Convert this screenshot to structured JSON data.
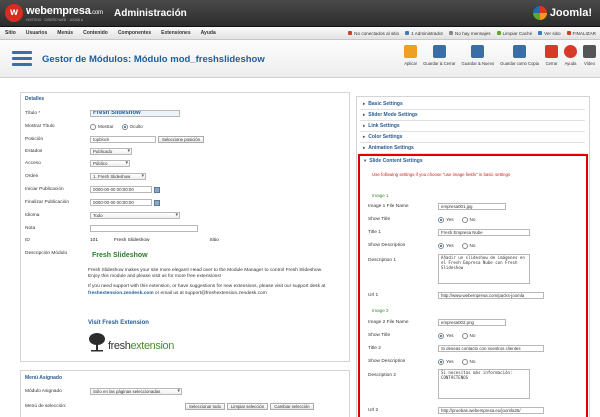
{
  "brand": {
    "logo_name": "webempresa",
    "logo_domain": ".com",
    "logo_sub": "HOSTING · DISEÑO WEB · JOOMLA",
    "admin_title": "Administración",
    "joomla": "Joomla!"
  },
  "menu": {
    "items": [
      "Sitio",
      "Usuarios",
      "Menús",
      "Contenido",
      "Componentes",
      "Extensiones",
      "Ayuda"
    ]
  },
  "status": [
    {
      "label": "No conectados al sitio",
      "color": "#d83a2a"
    },
    {
      "label": "1 Administrador",
      "color": "#3b7bbf"
    },
    {
      "label": "No hay mensajes",
      "color": "#888888"
    },
    {
      "label": "Limpiar Caché",
      "color": "#5aa82c"
    },
    {
      "label": "Ver sitio",
      "color": "#3b7bbf"
    },
    {
      "label": "FINALIZAR",
      "color": "#d83a2a"
    }
  ],
  "toolbar": {
    "title": "Gestor de Módulos: Módulo mod_freshslideshow",
    "buttons": [
      {
        "label": "Aplicar",
        "color": "#f0a020"
      },
      {
        "label": "Guardar & Cerrar",
        "color": "#3a6ea5"
      },
      {
        "label": "Guardar & Nuevo",
        "color": "#3a6ea5"
      },
      {
        "label": "Guardar como Copia",
        "color": "#3a6ea5"
      },
      {
        "label": "Cerrar",
        "color": "#d83a2a"
      },
      {
        "label": "Ayuda",
        "color": "#d83a2a"
      },
      {
        "label": "Vídeo",
        "color": "#555555"
      }
    ]
  },
  "details": {
    "heading": "Detalles",
    "title_label": "Título *",
    "title_value": "Fresh Slideshow",
    "show_title_label": "Mostrar Título",
    "show_opt": "Mostrar",
    "hide_opt": "Oculto",
    "position_label": "Posición",
    "position_value": "topblock",
    "position_button": "Seleccione posición",
    "state_label": "Estados",
    "state_value": "Publicado",
    "access_label": "Acceso",
    "access_value": "Público",
    "order_label": "Orden",
    "order_value": "1. Fresh Slideshow",
    "pub_start_label": "Iniciar Publicación",
    "pub_start_value": "0000-00-00 00:00:00",
    "pub_end_label": "Finalizar Publicación",
    "pub_end_value": "0000-00-00 00:00:00",
    "lang_label": "Idioma",
    "lang_value": "Todo",
    "note_label": "Nota",
    "note_value": "",
    "id_label": "ID",
    "id_value": "101",
    "id_name": "Fresh Slideshow",
    "id_site": "Sitio",
    "desc_label": "Descripción Módulo"
  },
  "module_desc": {
    "heading": "Fresh Slideshow",
    "para1": "Fresh Slideshow makes your site more elegant! Head over to the Module Manager to control Fresh Slideshow.",
    "para1b": "Enjoy this module and please visit us for more free extensions!",
    "para2": "If you need support with this extension, or have suggestions for new extensions, please visit our support desk at",
    "link1": "freshextension.zendesk.com",
    "or_email": " or email us at support@freshextension.zendesk.com",
    "visit": "Visit Fresh Extension",
    "logo_a": "fresh",
    "logo_b": "extension"
  },
  "menu_assign": {
    "heading": "Menú Asignado",
    "assign_label": "Módulo Asignado",
    "assign_value": "Sólo en las páginas seleccionadas",
    "sel_label": "Menú de selección:",
    "btn_all": "Seleccionar todo",
    "btn_clear": "Limpiar selección",
    "btn_toggle": "Cambiar selección"
  },
  "accordion": [
    "Basic Settings",
    "Slider Mode Settings",
    "Link Settings",
    "Color Settings",
    "Animation Settings"
  ],
  "slide": {
    "title": "Slide Content Settings",
    "note": "Use following settings if you choose \"use image fields\" in basic settings",
    "yes": "Yes",
    "no": "No",
    "img1": {
      "label": "Image 1",
      "file_label": "Image 1 File Name",
      "file_value": "empresa001.jpg",
      "show_title_label": "Show Title",
      "title_label": "Title 1",
      "title_value": "Fresh Empresa Nube",
      "show_desc_label": "Show Description",
      "desc_label": "Description 1",
      "desc_value": "Añadir un slideshow de imágenes en el Fresh Empresa Nube con Fresh Slideshow",
      "url_label": "Url 1",
      "url_value": "http://www.webempresa.com/packs-joomla"
    },
    "img2": {
      "label": "Image 2",
      "file_label": "Image 2 File Name",
      "file_value": "empresa002.png",
      "show_title_label": "Show Title",
      "title_label": "Title 2",
      "title_value": "Si deseas contacto con nuestros clientes",
      "show_desc_label": "Show Description",
      "desc_label": "Description 2",
      "desc_value": "Si necesitas más información: CONTÁCTENOS",
      "url_label": "Url 2",
      "url_value": "http://pruebas.webempresa.eu/joomla25/"
    }
  }
}
